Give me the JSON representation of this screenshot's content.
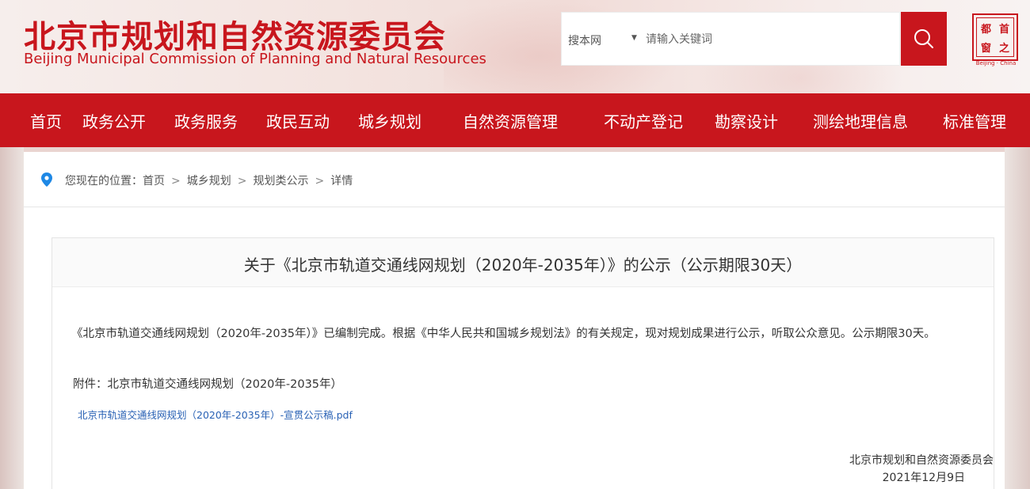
{
  "header": {
    "title_cn": "北京市规划和自然资源委员会",
    "title_en": "Beijing Municipal Commission of Planning and Natural Resources",
    "seal_chars": [
      "首",
      "都",
      "之",
      "窗"
    ],
    "seal_caption": "Beijing · China"
  },
  "search": {
    "scope": "搜本网",
    "placeholder": "请输入关键词"
  },
  "nav": {
    "items": [
      "首页",
      "政务公开",
      "政务服务",
      "政民互动",
      "城乡规划",
      "自然资源管理",
      "不动产登记",
      "勘察设计",
      "测绘地理信息",
      "标准管理"
    ]
  },
  "breadcrumb": {
    "prefix": "您现在的位置：",
    "items": [
      "首页",
      "城乡规划",
      "规划类公示",
      "详情"
    ],
    "separator": ">"
  },
  "article": {
    "title": "关于《北京市轨道交通线网规划（2020年-2035年）》的公示（公示期限30天）",
    "paragraph": "《北京市轨道交通线网规划（2020年-2035年）》已编制完成。根据《中华人民共和国城乡规划法》的有关规定，现对规划成果进行公示，听取公众意见。公示期限30天。",
    "attachment_label": "附件：北京市轨道交通线网规划（2020年-2035年）",
    "attachment_link": "北京市轨道交通线网规划（2020年-2035年）-宣贯公示稿.pdf",
    "signature_org": "北京市规划和自然资源委员会",
    "signature_date": "2021年12月9日"
  },
  "colors": {
    "brand_red": "#c8161d",
    "link_blue": "#2a62b5"
  },
  "icons": {
    "search": "search-icon",
    "location": "location-pin-icon",
    "dropdown": "caret-down-icon"
  }
}
